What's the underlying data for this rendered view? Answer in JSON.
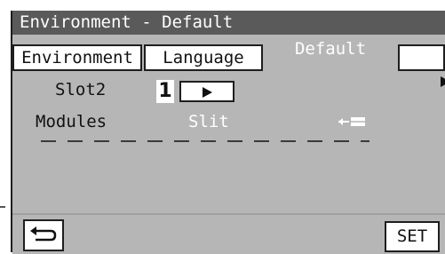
{
  "window": {
    "title": "Environment - Default"
  },
  "tabs": [
    {
      "label": "Environment",
      "active": false
    },
    {
      "label": "Language",
      "active": false
    },
    {
      "label": "Default",
      "active": true
    }
  ],
  "tab_next_icon": "right-triangle-icon",
  "slot": {
    "label": "Slot2",
    "number": "1",
    "button_icon": "play-arrow-icon"
  },
  "modules": {
    "label": "Modules",
    "value": "Slit",
    "icon": "module-insert-icon"
  },
  "footer": {
    "back_icon": "return-arrow-icon",
    "set_label": "SET"
  },
  "colors": {
    "panel": "#b6b6b6",
    "title_bar": "#5a5a5a",
    "active_text": "#ffffff",
    "border": "#1e1e1e"
  }
}
